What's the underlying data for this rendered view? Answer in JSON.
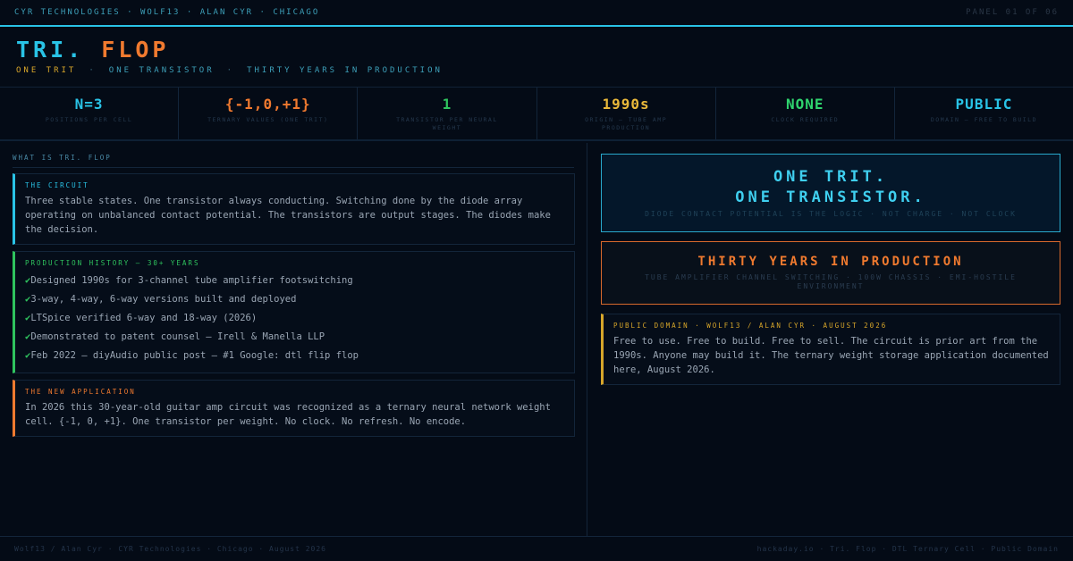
{
  "topbar": {
    "left": "CYR TECHNOLOGIES · WOLF13 · ALAN CYR · CHICAGO",
    "right": "PANEL 01 OF 06"
  },
  "header": {
    "title_part1": "TRI.",
    "title_part2": "FLOP",
    "subtitle": [
      "ONE TRIT",
      "ONE TRANSISTOR",
      "THIRTY YEARS IN PRODUCTION"
    ],
    "separator": "·"
  },
  "stats": [
    {
      "value": "N=3",
      "label": "POSITIONS PER CELL",
      "color": "#29c3e6"
    },
    {
      "value": "{-1,0,+1}",
      "label": "TERNARY VALUES (ONE TRIT)",
      "color": "#f07a2f"
    },
    {
      "value": "1",
      "label": "TRANSISTOR PER NEURAL WEIGHT",
      "color": "#2fc45e"
    },
    {
      "value": "1990s",
      "label": "ORIGIN — TUBE AMP PRODUCTION",
      "color": "#e9b83a"
    },
    {
      "value": "NONE",
      "label": "CLOCK REQUIRED",
      "color": "#2fd46e"
    },
    {
      "value": "PUBLIC",
      "label": "DOMAIN — FREE TO BUILD",
      "color": "#29c3e6"
    }
  ],
  "left": {
    "section_title": "WHAT IS TRI. FLOP",
    "circuit": {
      "heading": "THE CIRCUIT",
      "body": "Three stable states. One transistor always conducting. Switching done by the diode array operating on unbalanced contact potential. The transistors are output stages. The diodes make the decision."
    },
    "history": {
      "heading": "PRODUCTION HISTORY — 30+ YEARS",
      "check": "✔",
      "items": [
        "Designed 1990s for 3-channel tube amplifier footswitching",
        "3-way, 4-way, 6-way versions built and deployed",
        "LTSpice verified 6-way and 18-way (2026)",
        "Demonstrated to patent counsel — Irell & Manella LLP",
        "Feb 2022 — diyAudio public post — #1 Google: dtl flip flop"
      ]
    },
    "application": {
      "heading": "THE NEW APPLICATION",
      "body": "In 2026 this 30-year-old guitar amp circuit was recognized as a ternary neural network weight cell. {-1, 0, +1}. One transistor per weight. No clock. No refresh. No encode."
    }
  },
  "right": {
    "box1": {
      "line1": "ONE TRIT.",
      "line2": "ONE TRANSISTOR.",
      "small": "DIODE CONTACT POTENTIAL IS THE LOGIC · NOT CHARGE · NOT CLOCK"
    },
    "box2": {
      "big": "THIRTY YEARS IN PRODUCTION",
      "small": "TUBE AMPLIFIER CHANNEL SWITCHING · 100W CHASSIS · EMI-HOSTILE ENVIRONMENT"
    },
    "domain": {
      "heading": "PUBLIC DOMAIN · WOLF13 / ALAN CYR · AUGUST 2026",
      "body": "Free to use. Free to build. Free to sell. The circuit is prior art from the 1990s. Anyone may build it. The ternary weight storage application documented here, August 2026."
    }
  },
  "footer": {
    "left": "Wolf13 / Alan Cyr · CYR Technologies · Chicago · August 2026",
    "right": "hackaday.io · Tri. Flop · DTL Ternary Cell · Public Domain"
  }
}
